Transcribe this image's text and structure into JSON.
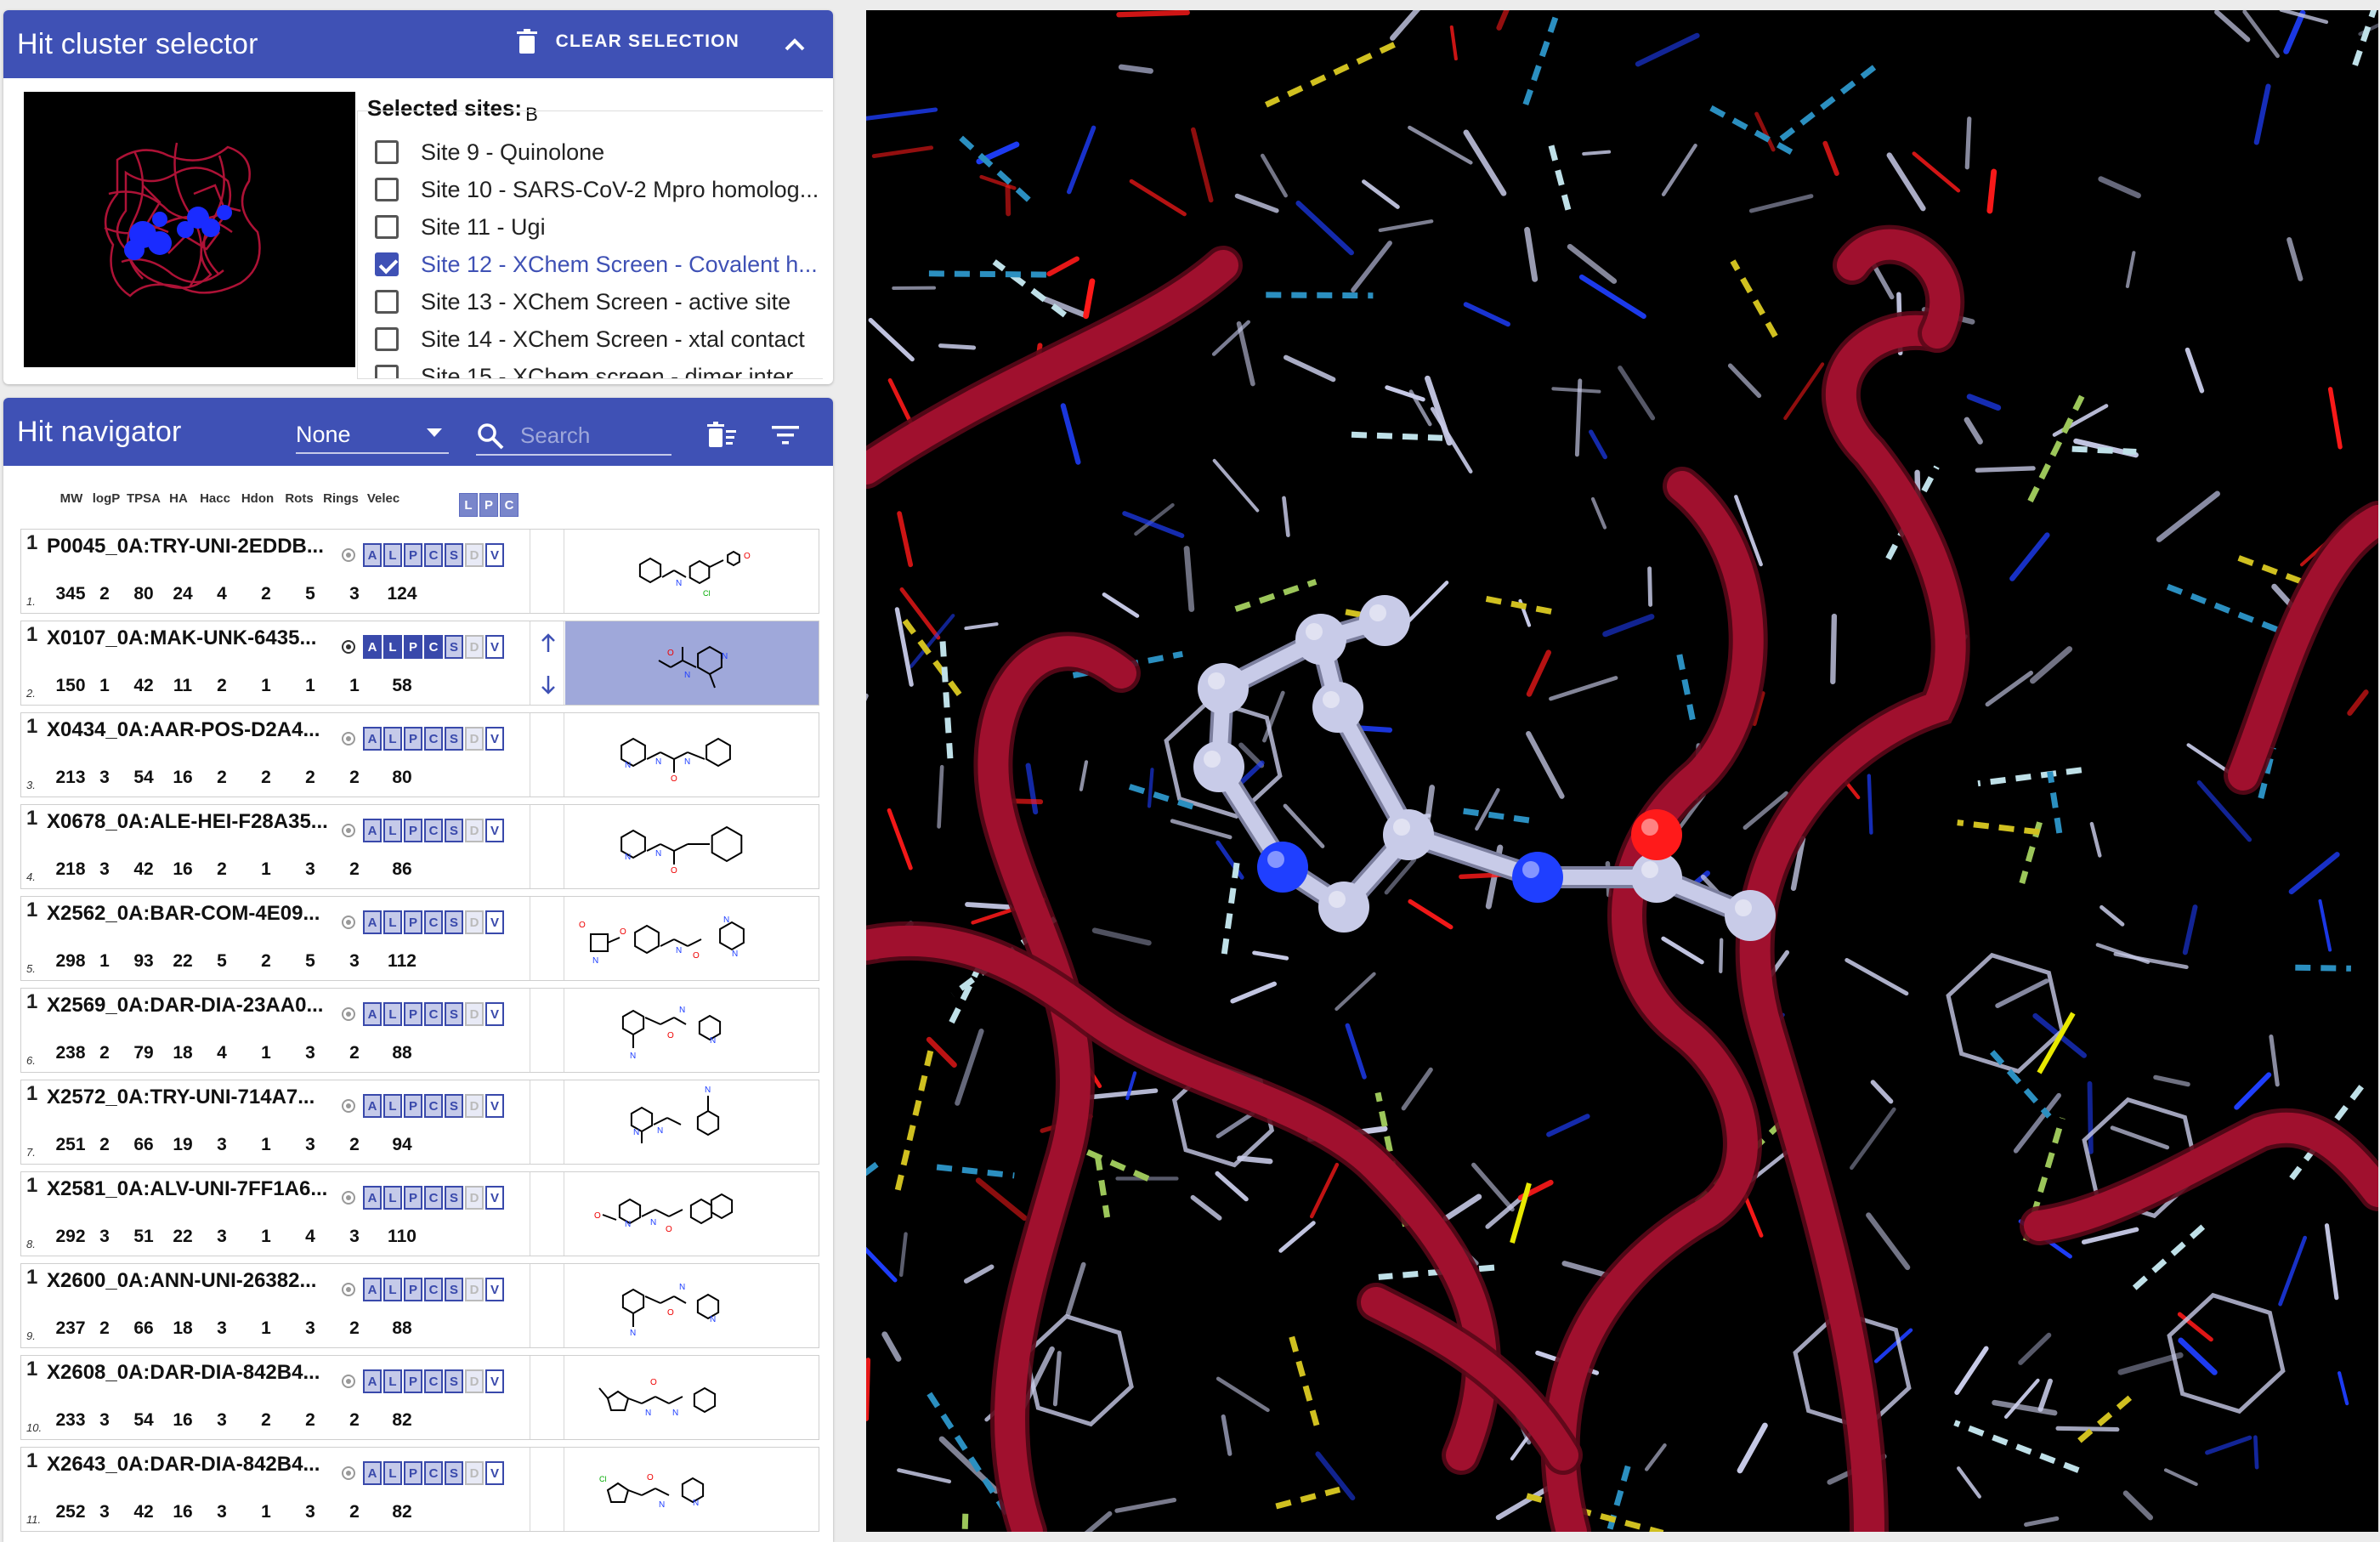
{
  "cluster_selector": {
    "title": "Hit cluster selector",
    "clear_label": "CLEAR SELECTION",
    "selected_label": "Selected sites:",
    "selected_value": "B",
    "sites": [
      {
        "label": "Site 9 - Quinolone",
        "checked": false
      },
      {
        "label": "Site 10 - SARS-CoV-2 Mpro homolog...",
        "checked": false
      },
      {
        "label": "Site 11 - Ugi",
        "checked": false
      },
      {
        "label": "Site 12 - XChem Screen - Covalent h...",
        "checked": true
      },
      {
        "label": "Site 13 - XChem Screen - active site",
        "checked": false
      },
      {
        "label": "Site 14 - XChem Screen - xtal contact",
        "checked": false
      },
      {
        "label": "Site 15 - XChem screen - dimer inter...",
        "checked": false
      }
    ]
  },
  "navigator": {
    "title": "Hit navigator",
    "select_value": "None",
    "search_placeholder": "Search",
    "columns": [
      "MW",
      "logP",
      "TPSA",
      "HA",
      "Hacc",
      "Hdon",
      "Rots",
      "Rings",
      "Velec"
    ],
    "lpc_header": [
      "L",
      "P",
      "C"
    ],
    "tag_letters": [
      "A",
      "L",
      "P",
      "C",
      "S",
      "D",
      "V"
    ],
    "hits": [
      {
        "no": "1",
        "idx": "1.",
        "name": "P0045_0A:TRY-UNI-2EDDB...",
        "props": [
          "345",
          "2",
          "80",
          "24",
          "4",
          "2",
          "5",
          "3",
          "124"
        ],
        "selected": false
      },
      {
        "no": "1",
        "idx": "2.",
        "name": "X0107_0A:MAK-UNK-6435...",
        "props": [
          "150",
          "1",
          "42",
          "11",
          "2",
          "1",
          "1",
          "1",
          "58"
        ],
        "selected": true
      },
      {
        "no": "1",
        "idx": "3.",
        "name": "X0434_0A:AAR-POS-D2A4...",
        "props": [
          "213",
          "3",
          "54",
          "16",
          "2",
          "2",
          "2",
          "2",
          "80"
        ],
        "selected": false
      },
      {
        "no": "1",
        "idx": "4.",
        "name": "X0678_0A:ALE-HEI-F28A35...",
        "props": [
          "218",
          "3",
          "42",
          "16",
          "2",
          "1",
          "3",
          "2",
          "86"
        ],
        "selected": false
      },
      {
        "no": "1",
        "idx": "5.",
        "name": "X2562_0A:BAR-COM-4E09...",
        "props": [
          "298",
          "1",
          "93",
          "22",
          "5",
          "2",
          "5",
          "3",
          "112"
        ],
        "selected": false
      },
      {
        "no": "1",
        "idx": "6.",
        "name": "X2569_0A:DAR-DIA-23AA0...",
        "props": [
          "238",
          "2",
          "79",
          "18",
          "4",
          "1",
          "3",
          "2",
          "88"
        ],
        "selected": false
      },
      {
        "no": "1",
        "idx": "7.",
        "name": "X2572_0A:TRY-UNI-714A7...",
        "props": [
          "251",
          "2",
          "66",
          "19",
          "3",
          "1",
          "3",
          "2",
          "94"
        ],
        "selected": false
      },
      {
        "no": "1",
        "idx": "8.",
        "name": "X2581_0A:ALV-UNI-7FF1A6...",
        "props": [
          "292",
          "3",
          "51",
          "22",
          "3",
          "1",
          "4",
          "3",
          "110"
        ],
        "selected": false
      },
      {
        "no": "1",
        "idx": "9.",
        "name": "X2600_0A:ANN-UNI-26382...",
        "props": [
          "237",
          "2",
          "66",
          "18",
          "3",
          "1",
          "3",
          "2",
          "88"
        ],
        "selected": false
      },
      {
        "no": "1",
        "idx": "10.",
        "name": "X2608_0A:DAR-DIA-842B4...",
        "props": [
          "233",
          "3",
          "54",
          "16",
          "3",
          "2",
          "2",
          "2",
          "82"
        ],
        "selected": false
      },
      {
        "no": "1",
        "idx": "11.",
        "name": "X2643_0A:DAR-DIA-842B4...",
        "props": [
          "252",
          "3",
          "42",
          "16",
          "3",
          "1",
          "3",
          "2",
          "82"
        ],
        "selected": false
      }
    ]
  },
  "colors": {
    "primary": "#3f51b5",
    "ribbon": "#a0102e",
    "bond": "#c8cbe8",
    "oxygen": "#ff1a1a",
    "nitrogen": "#1f3fff",
    "hbond": "#2b8fc0",
    "sulfur": "#e8e800"
  },
  "icons": {
    "clear": "trash-icon",
    "collapse": "chevron-up-icon",
    "search": "search-icon",
    "delete_filter": "delete-sweep-icon",
    "filter": "filter-icon"
  }
}
